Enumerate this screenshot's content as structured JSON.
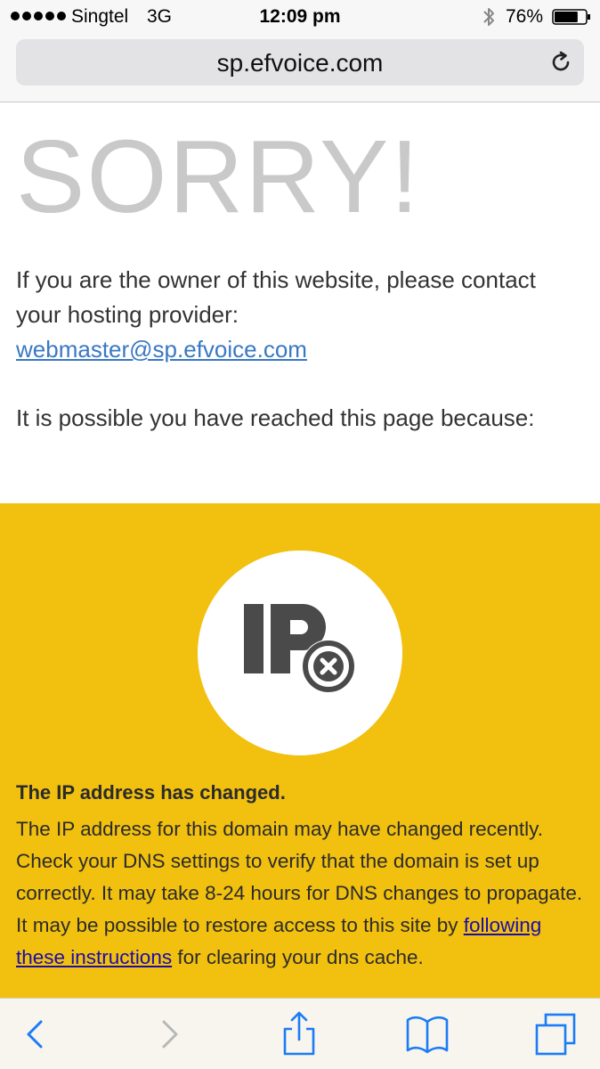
{
  "status_bar": {
    "carrier": "Singtel",
    "network": "3G",
    "time": "12:09 pm",
    "battery_percent": "76%",
    "battery_level": 0.76,
    "signal_bars": 5,
    "bluetooth_icon": "bluetooth-icon",
    "battery_icon": "battery-icon"
  },
  "browser": {
    "url": "sp.efvoice.com",
    "reload_icon": "reload-icon"
  },
  "page": {
    "heading": "SORRY!",
    "owner_text": "If you are the owner of this website, please contact your hosting provider:",
    "owner_email": "webmaster@sp.efvoice.com",
    "reason_intro": "It is possible you have reached this page because:",
    "reason_card": {
      "icon": "ip-error-icon",
      "title": "The IP address has changed.",
      "desc_before_link": "The IP address for this domain may have changed recently. Check your DNS settings to verify that the domain is set up correctly. It may take 8-24 hours for DNS changes to propagate. It may be possible to restore access to this site by",
      "link_text": "following these instructions",
      "desc_after_link": "for clearing your dns cache."
    }
  },
  "toolbar": {
    "back_icon": "chevron-left-icon",
    "forward_icon": "chevron-right-icon",
    "share_icon": "share-icon",
    "bookmarks_icon": "book-icon",
    "tabs_icon": "tabs-icon"
  },
  "colors": {
    "accent_yellow": "#f2c00f",
    "link_blue": "#3a78c3",
    "toolbar_blue": "#1a7cf6",
    "heading_gray": "#c9c9c9"
  }
}
